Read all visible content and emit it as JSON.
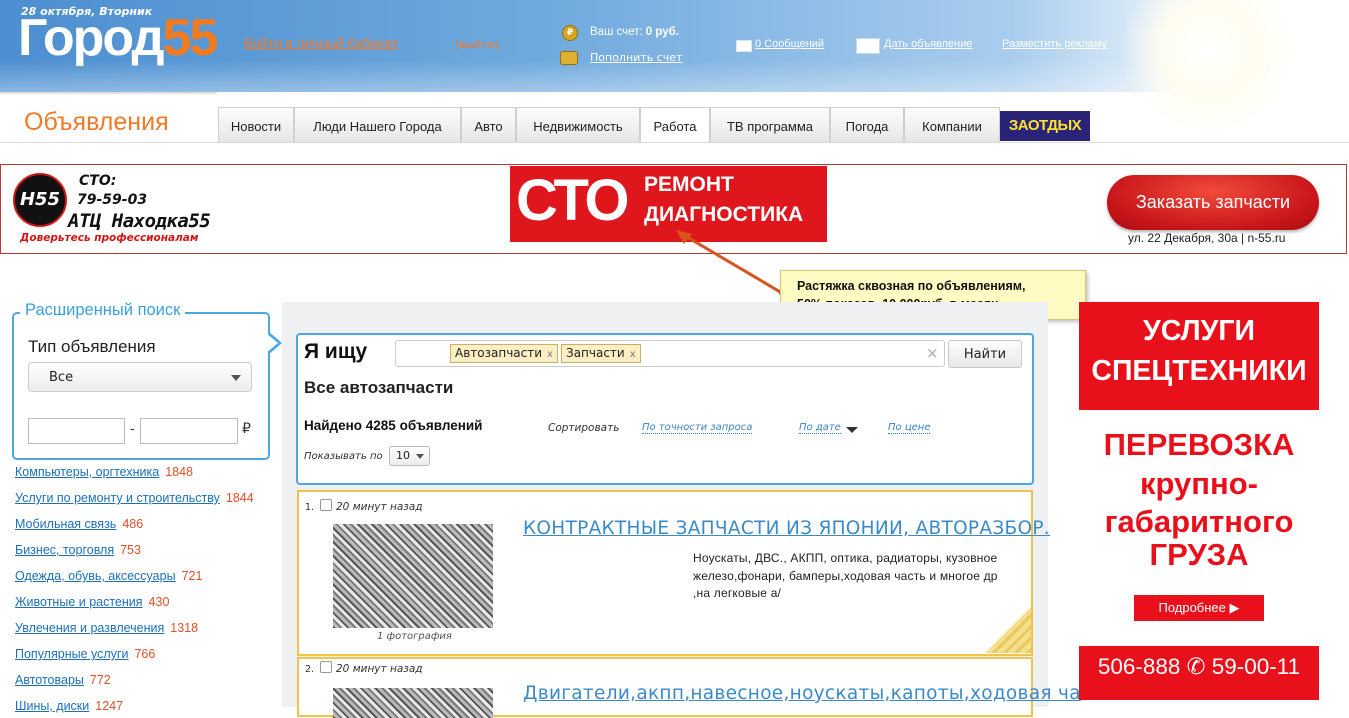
{
  "header": {
    "date": "28 октября, Вторник",
    "logo_text": "Город",
    "logo_number": "55",
    "login_link": "Войти в личный Кабинет",
    "logout_link": "(выйти)",
    "account_label": "Ваш счет:",
    "account_value": "0 руб.",
    "topup_link": "Пополнить счет",
    "messages_link": "0 Сообщений",
    "post_ad_link": "Дать объявление",
    "place_ad_link": "Разместить рекламу"
  },
  "nav": {
    "active_tab": "Объявления",
    "tabs": [
      "Новости",
      "Люди Нашего Города",
      "Авто",
      "Недвижимость",
      "Работа",
      "ТВ программа",
      "Погода",
      "Компании"
    ],
    "promo_tab": "ЗАОТДЫХ"
  },
  "banner": {
    "logo_text": "Н55",
    "sto_label": "СТО:",
    "sto_phone": "79-59-03",
    "sto_name": "АТЦ Находка55",
    "slogan": "Доверьтесь профессионалам",
    "big_text": "СТО",
    "service1": "РЕМОНТ",
    "service2": "ДИАГНОСТИКА",
    "order_button": "Заказать запчасти",
    "address": "ул. 22 Декабря, 30а | n-55.ru"
  },
  "note": {
    "line1": "Растяжка сквозная по объявлениям,",
    "line2": "50% показов, 10 000руб. в месяц."
  },
  "advanced_search": {
    "title": "Расширенный поиск",
    "type_label": "Тип объявления",
    "type_value": "Все",
    "price_from": "",
    "price_to": "",
    "dash": "-",
    "currency": "₽"
  },
  "categories": [
    {
      "name": "Компьютеры, оргтехника",
      "count": "1848"
    },
    {
      "name": "Услуги по ремонту и строительству",
      "count": "1844"
    },
    {
      "name": "Мобильная связь",
      "count": "486"
    },
    {
      "name": "Бизнес, торговля",
      "count": "753"
    },
    {
      "name": "Одежда, обувь, аксессуары",
      "count": "721"
    },
    {
      "name": "Животные и растения",
      "count": "430"
    },
    {
      "name": "Увлечения и развлечения",
      "count": "1318"
    },
    {
      "name": "Популярные услуги",
      "count": "766"
    },
    {
      "name": "Автотовары",
      "count": "772"
    },
    {
      "name": "Шины, диски",
      "count": "1247"
    }
  ],
  "search": {
    "label": "Я ищу",
    "tags": [
      "Автозапчасти",
      "Запчасти"
    ],
    "tag_remove": "x",
    "clear": "×",
    "find_button": "Найти",
    "heading": "Все автозапчасти",
    "found_text": "Найдено 4285 объявлений",
    "sort_label": "Сортировать",
    "sort_options": [
      "По точности запроса",
      "По дате",
      "По цене"
    ],
    "show_label": "Показывать по",
    "show_value": "10"
  },
  "listings": [
    {
      "num": "1.",
      "time": "20 минут назад",
      "title": "КОНТРАКТНЫЕ ЗАПЧАСТИ ИЗ ЯПОНИИ, АВТОРАЗБОР.",
      "desc1": "Ноускаты, ДВС., АКПП, оптика, радиаторы, кузовное",
      "desc2": "железо,фонари, бамперы,ходовая часть и многое др",
      "desc3": ",на легковые а/",
      "photos": "1 фотография"
    },
    {
      "num": "2.",
      "time": "20 минут назад",
      "title": "Двигатели,акпп,навесное,ноускаты,капоты,ходовая ча"
    }
  ],
  "right_ad": {
    "line1": "УСЛУГИ",
    "line2": "СПЕЦТЕХНИКИ",
    "r1": "ПЕРЕВОЗКА",
    "r2": "крупно-",
    "r3": "габаритного",
    "r4": "ГРУЗА",
    "more": "Подробнее",
    "phone": "506-888 ✆ 59-00-11"
  }
}
